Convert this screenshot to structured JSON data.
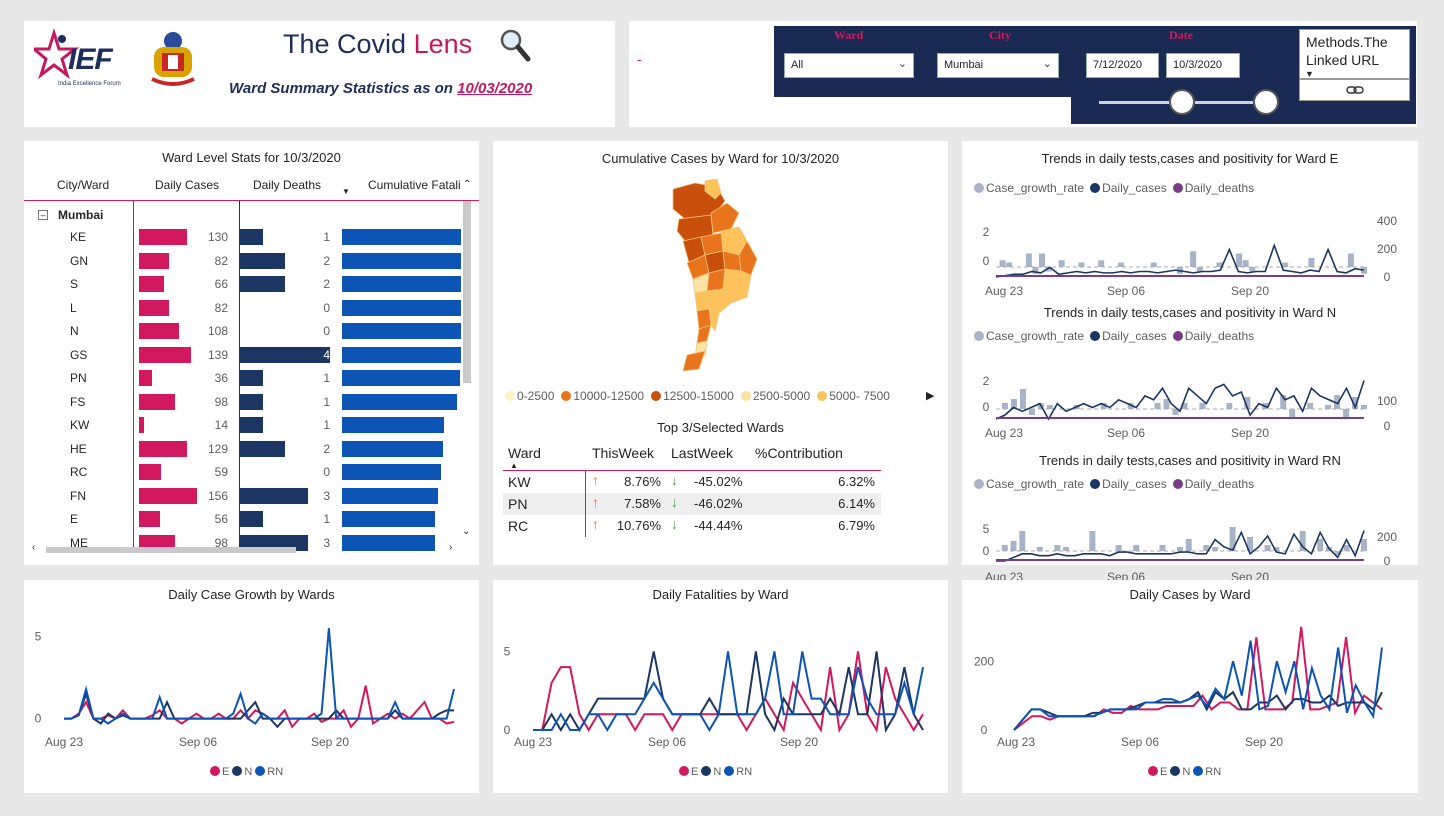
{
  "header": {
    "logo_text": "IEF",
    "logo_sub": "India Excellence Forum",
    "title_main": "The Covid ",
    "title_accent": "Lens",
    "subtitle_prefix": "Ward Summary Statistics as on ",
    "subtitle_date": "10/03/2020"
  },
  "filters": {
    "dash": "-",
    "ward_label": "Ward",
    "ward_value": "All",
    "city_label": "City",
    "city_value": "Mumbai",
    "date_label": "Date",
    "date_from": "7/12/2020",
    "date_to": "10/3/2020",
    "methods_text": "Methods.The Linked URL"
  },
  "ward_table": {
    "title": "Ward Level Stats for 10/3/2020",
    "columns": [
      "City/Ward",
      "Daily Cases",
      "Daily Deaths",
      "Cumulative Fatalit"
    ],
    "group": "Mumbai",
    "rows": [
      {
        "ward": "KE",
        "cases": 130,
        "deaths": 1,
        "fatal": 1.0
      },
      {
        "ward": "GN",
        "cases": 82,
        "deaths": 2,
        "fatal": 1.0
      },
      {
        "ward": "S",
        "cases": 66,
        "deaths": 2,
        "fatal": 1.0
      },
      {
        "ward": "L",
        "cases": 82,
        "deaths": 0,
        "fatal": 1.0
      },
      {
        "ward": "N",
        "cases": 108,
        "deaths": 0,
        "fatal": 1.0
      },
      {
        "ward": "GS",
        "cases": 139,
        "deaths": 4,
        "fatal": 1.0
      },
      {
        "ward": "PN",
        "cases": 36,
        "deaths": 1,
        "fatal": 0.99
      },
      {
        "ward": "FS",
        "cases": 98,
        "deaths": 1,
        "fatal": 0.97
      },
      {
        "ward": "KW",
        "cases": 14,
        "deaths": 1,
        "fatal": 0.86
      },
      {
        "ward": "HE",
        "cases": 129,
        "deaths": 2,
        "fatal": 0.85
      },
      {
        "ward": "RC",
        "cases": 59,
        "deaths": 0,
        "fatal": 0.83
      },
      {
        "ward": "FN",
        "cases": 156,
        "deaths": 3,
        "fatal": 0.81
      },
      {
        "ward": "E",
        "cases": 56,
        "deaths": 1,
        "fatal": 0.78
      },
      {
        "ward": "ME",
        "cases": 98,
        "deaths": 3,
        "fatal": 0.78
      }
    ],
    "colors": {
      "cases": "#d2185f",
      "deaths": "#1b3662",
      "fatal": "#0c54b5"
    }
  },
  "map_panel": {
    "title": "Cumulative Cases by Ward for 10/3/2020",
    "legend": [
      {
        "label": "0-2500",
        "color": "#fdf2c8"
      },
      {
        "label": "10000-12500",
        "color": "#e8741c"
      },
      {
        "label": "12500-15000",
        "color": "#c94f0c"
      },
      {
        "label": "2500-5000",
        "color": "#fde2a0"
      },
      {
        "label": "5000- 7500",
        "color": "#fbc35a"
      }
    ],
    "top3_title": "Top 3/Selected Wards",
    "top3_columns": [
      "Ward",
      "ThisWeek",
      "LastWeek",
      "%Contribution"
    ],
    "top3_rows": [
      {
        "ward": "KW",
        "this": "8.76%",
        "last": "-45.02%",
        "contrib": "6.32%"
      },
      {
        "ward": "PN",
        "this": "7.58%",
        "last": "-46.02%",
        "contrib": "6.14%"
      },
      {
        "ward": "RC",
        "this": "10.76%",
        "last": "-44.44%",
        "contrib": "6.79%"
      }
    ]
  },
  "trend_panels": [
    {
      "title": "Trends in daily tests,cases and positivity for Ward E",
      "legend": [
        "Case_growth_rate",
        "Daily_cases",
        "Daily_deaths"
      ],
      "yleft": [
        "2",
        "0"
      ],
      "yright": [
        "400",
        "200",
        "0"
      ],
      "xticks": [
        "Aug 23",
        "Sep 06",
        "Sep 20"
      ]
    },
    {
      "title": "Trends in daily tests,cases and positivity in Ward N",
      "legend": [
        "Case_growth_rate",
        "Daily_cases",
        "Daily_deaths"
      ],
      "yleft": [
        "2",
        "0"
      ],
      "yright": [
        "100",
        "0"
      ],
      "xticks": [
        "Aug 23",
        "Sep 06",
        "Sep 20"
      ]
    },
    {
      "title": "Trends in daily tests,cases and positivity in Ward RN",
      "legend": [
        "Case_growth_rate",
        "Daily_cases",
        "Daily_deaths"
      ],
      "yleft": [
        "5",
        "0"
      ],
      "yright": [
        "200",
        "0"
      ],
      "xticks": [
        "Aug 23",
        "Sep 06",
        "Sep 20"
      ]
    }
  ],
  "legend_colors": {
    "growth": "#a7b4c8",
    "cases": "#1b3662",
    "deaths": "#7a3c86"
  },
  "bottom_legend": [
    "E",
    "N",
    "RN"
  ],
  "series_colors": {
    "E": "#d2185f",
    "N": "#1b3662",
    "RN": "#0c54b5"
  },
  "chart_data": [
    {
      "type": "line",
      "title": "Daily Case Growth by Wards",
      "xticks": [
        "Aug 23",
        "Sep 06",
        "Sep 20"
      ],
      "ylim": [
        -1,
        6
      ],
      "yticks": [
        0,
        5
      ],
      "series": [
        {
          "name": "E",
          "values": [
            0,
            0,
            0.3,
            1,
            0,
            0,
            0.2,
            0,
            0.5,
            0,
            0,
            0,
            0.2,
            0.5,
            0,
            0,
            -0.3,
            0,
            0.3,
            0,
            0,
            0.3,
            0,
            0,
            0.5,
            0,
            0.5,
            0.3,
            0,
            0,
            0.5,
            -0.5,
            0,
            0,
            0.3,
            -0.2,
            0,
            0,
            0.5,
            -0.5,
            0,
            2,
            -0.3,
            0,
            0.3,
            0,
            0.3,
            0,
            0.5,
            1,
            0,
            0,
            -0.3,
            -0.2
          ]
        },
        {
          "name": "N",
          "values": [
            0,
            0,
            0.2,
            1.5,
            0,
            -0.3,
            0.3,
            0,
            0.2,
            0,
            0,
            0,
            0,
            0,
            1,
            0,
            0,
            0,
            0,
            0,
            0,
            0,
            0,
            0,
            0,
            0.5,
            1,
            0,
            0,
            -0.5,
            0,
            0,
            0,
            0,
            0,
            0,
            0,
            0.5,
            0,
            0,
            0,
            0,
            0,
            0,
            0,
            0.5,
            0,
            0,
            0,
            0,
            0,
            0.3,
            0.5,
            0.5
          ]
        },
        {
          "name": "RN",
          "values": [
            0,
            0,
            0.2,
            1.8,
            0,
            0,
            -0.3,
            0,
            0.3,
            0,
            0,
            0,
            0,
            1.3,
            0,
            0,
            0,
            0,
            0,
            0,
            0,
            0,
            0,
            0.3,
            1.5,
            0,
            -0.3,
            0.3,
            0,
            0,
            0,
            0,
            0,
            0,
            0,
            0.3,
            5.5,
            0,
            0,
            0,
            0,
            0,
            0,
            0,
            0,
            1,
            0,
            0,
            0,
            0,
            0,
            0,
            0,
            1.8
          ]
        }
      ]
    },
    {
      "type": "line",
      "title": "Daily Fatalities by Ward",
      "xticks": [
        "Aug 23",
        "Sep 06",
        "Sep 20"
      ],
      "ylim": [
        0,
        7
      ],
      "yticks": [
        0,
        5
      ],
      "series": [
        {
          "name": "E",
          "values": [
            0,
            0,
            3,
            4,
            4,
            1,
            0,
            1,
            1,
            1,
            1,
            0,
            1,
            1,
            1,
            0,
            1,
            1,
            1,
            1,
            1,
            1,
            1,
            0,
            1,
            2,
            1,
            0,
            3,
            2,
            1,
            0,
            4,
            0,
            1,
            5,
            1,
            0,
            4,
            2,
            1,
            0,
            1
          ]
        },
        {
          "name": "N",
          "values": [
            0,
            0,
            1,
            0,
            1,
            0,
            1,
            2,
            2,
            2,
            2,
            2,
            2,
            5,
            2,
            1,
            1,
            1,
            1,
            2,
            1,
            1,
            1,
            1,
            5,
            1,
            0,
            2,
            1,
            1,
            1,
            1,
            2,
            1,
            4,
            1,
            1,
            5,
            0,
            1,
            4,
            1,
            0
          ]
        },
        {
          "name": "RN",
          "values": [
            0,
            0,
            0,
            1,
            0,
            0,
            1,
            1,
            0,
            1,
            1,
            1,
            2,
            3,
            2,
            1,
            1,
            1,
            1,
            0,
            1,
            5,
            1,
            1,
            1,
            2,
            5,
            1,
            1,
            5,
            2,
            2,
            1,
            1,
            1,
            4,
            2,
            1,
            1,
            1,
            3,
            1,
            4
          ]
        }
      ]
    },
    {
      "type": "line",
      "title": "Daily Cases by Ward",
      "xticks": [
        "Aug 23",
        "Sep 06",
        "Sep 20"
      ],
      "ylim": [
        0,
        320
      ],
      "yticks": [
        0,
        200
      ],
      "series": [
        {
          "name": "E",
          "values": [
            0,
            20,
            40,
            40,
            30,
            40,
            40,
            40,
            40,
            40,
            60,
            50,
            50,
            70,
            60,
            60,
            60,
            70,
            70,
            70,
            70,
            100,
            60,
            80,
            80,
            60,
            60,
            270,
            60,
            60,
            60,
            80,
            300,
            60,
            60,
            70,
            80,
            270,
            50,
            100,
            80,
            60
          ]
        },
        {
          "name": "N",
          "values": [
            0,
            30,
            60,
            60,
            50,
            40,
            40,
            40,
            40,
            50,
            50,
            60,
            60,
            60,
            70,
            80,
            80,
            80,
            80,
            80,
            90,
            110,
            60,
            110,
            90,
            110,
            60,
            60,
            80,
            80,
            100,
            60,
            90,
            90,
            80,
            80,
            100,
            70,
            80,
            80,
            80,
            60,
            110
          ]
        },
        {
          "name": "RN",
          "values": [
            0,
            30,
            60,
            60,
            40,
            40,
            40,
            40,
            40,
            40,
            50,
            60,
            60,
            60,
            60,
            80,
            80,
            90,
            90,
            80,
            90,
            100,
            70,
            120,
            90,
            200,
            100,
            260,
            60,
            70,
            200,
            110,
            200,
            60,
            180,
            100,
            60,
            240,
            50,
            130,
            80,
            40,
            240
          ]
        }
      ]
    }
  ],
  "mini_trend_data": [
    {
      "growth": [
        0,
        0.3,
        0.2,
        0,
        0,
        0.6,
        -0.3,
        0.6,
        -0.2,
        0,
        0.3,
        0,
        0,
        0.2,
        0,
        0,
        0.3,
        0,
        0,
        0.2,
        0,
        0,
        0,
        0,
        0.2,
        0,
        0,
        0,
        -0.3,
        0,
        0.7,
        -0.2,
        0,
        0,
        0.2,
        0,
        0,
        0.6,
        0.3,
        -0.2,
        0,
        0,
        0,
        0,
        0.2,
        0,
        0,
        0,
        0.4,
        0,
        0,
        0,
        0,
        0,
        0.6,
        0,
        -0.3
      ],
      "cases": [
        0,
        10,
        20,
        20,
        40,
        30,
        70,
        20,
        30,
        40,
        30,
        40,
        30,
        30,
        40,
        30,
        40,
        40,
        30,
        40,
        50,
        40,
        30,
        40,
        40,
        50,
        200,
        40,
        30,
        40,
        40,
        230,
        50,
        40,
        30,
        50,
        40,
        200,
        40,
        30,
        60,
        50
      ],
      "deaths": [
        0,
        0,
        0,
        0,
        0,
        0,
        0,
        0,
        0,
        0,
        0,
        0,
        0,
        0,
        0,
        0,
        0,
        0,
        0,
        0,
        0,
        0,
        0,
        0,
        0,
        0,
        0,
        0,
        0,
        0,
        0,
        0,
        0,
        0,
        0,
        0,
        0,
        0,
        0,
        0,
        0,
        0
      ],
      "cmax": 400
    },
    {
      "growth": [
        0,
        0.3,
        0.5,
        1,
        -0.3,
        0.3,
        0.2,
        0,
        0,
        0.2,
        0,
        0,
        0.3,
        0,
        0,
        0.3,
        0,
        0,
        0.3,
        0.5,
        -0.3,
        0.3,
        0,
        0.3,
        0,
        0,
        0.3,
        0,
        0.6,
        0,
        0.3,
        0,
        0.7,
        -0.4,
        0,
        0.3,
        0,
        0.2,
        0.7,
        -0.4,
        0.6,
        0.2
      ],
      "cases": [
        0,
        10,
        30,
        20,
        30,
        40,
        0,
        40,
        20,
        30,
        40,
        30,
        40,
        30,
        50,
        40,
        30,
        60,
        50,
        80,
        40,
        20,
        80,
        60,
        40,
        80,
        90,
        60,
        70,
        10,
        40,
        30,
        80,
        50,
        60,
        20,
        80,
        60,
        50,
        40,
        80,
        30,
        100
      ],
      "deaths": [
        0,
        0,
        0,
        0,
        0,
        0,
        0,
        0,
        0,
        0,
        0,
        0,
        0,
        0,
        0,
        0,
        0,
        0,
        0,
        0,
        0,
        0,
        0,
        0,
        0,
        0,
        0,
        0,
        0,
        0,
        0,
        0,
        0,
        0,
        0,
        0,
        0,
        0,
        0,
        0,
        0,
        0
      ],
      "cmax": 130
    },
    {
      "growth": [
        0,
        0.3,
        0.5,
        1,
        0,
        0.2,
        0,
        0.3,
        0.2,
        0,
        0,
        1,
        0,
        0,
        0.3,
        0,
        0.3,
        0,
        0,
        0.3,
        0,
        0.2,
        0.6,
        0,
        0.3,
        0.2,
        0,
        1.2,
        0,
        0.7,
        0,
        0.3,
        0.2,
        0,
        0,
        1,
        0,
        0.6,
        0.2,
        -0.2,
        0.3,
        0,
        0.6
      ],
      "cases": [
        0,
        0,
        20,
        40,
        40,
        30,
        30,
        40,
        30,
        30,
        40,
        40,
        40,
        30,
        50,
        50,
        40,
        40,
        40,
        40,
        40,
        50,
        50,
        40,
        40,
        120,
        80,
        60,
        160,
        40,
        80,
        140,
        50,
        40,
        150,
        80,
        40,
        160,
        70,
        20,
        120,
        30,
        170
      ],
      "deaths": [
        0,
        0,
        0,
        0,
        0,
        0,
        0,
        0,
        0,
        0,
        0,
        0,
        0,
        0,
        0,
        0,
        0,
        0,
        0,
        0,
        0,
        0,
        0,
        0,
        0,
        0,
        0,
        0,
        0,
        0,
        0,
        0,
        0,
        0,
        0,
        0,
        0,
        0,
        0,
        0,
        0,
        0
      ],
      "cmax": 280
    }
  ]
}
